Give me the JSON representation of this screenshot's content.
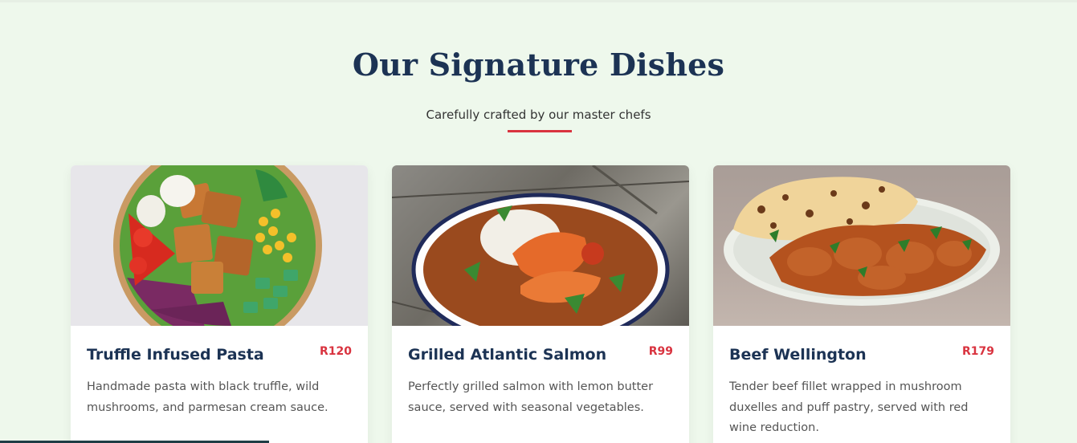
{
  "section": {
    "title": "Our Signature Dishes",
    "subtitle": "Carefully crafted by our master chefs"
  },
  "colors": {
    "background": "#eef8ec",
    "heading": "#1c3354",
    "accent": "#d9333f",
    "text": "#555555"
  },
  "dishes": [
    {
      "name": "Truffle Infused Pasta",
      "price": "R120",
      "description": "Handmade pasta with black truffle, wild mushrooms, and parmesan cream sauce.",
      "image": "salad-bowl-photo"
    },
    {
      "name": "Grilled Atlantic Salmon",
      "price": "R99",
      "description": "Perfectly grilled salmon with lemon butter sauce, served with seasonal vegetables.",
      "image": "prawn-curry-rice-photo"
    },
    {
      "name": "Beef Wellington",
      "price": "R179",
      "description": "Tender beef fillet wrapped in mushroom duxelles and puff pastry, served with red wine reduction.",
      "image": "curry-naan-photo"
    }
  ]
}
